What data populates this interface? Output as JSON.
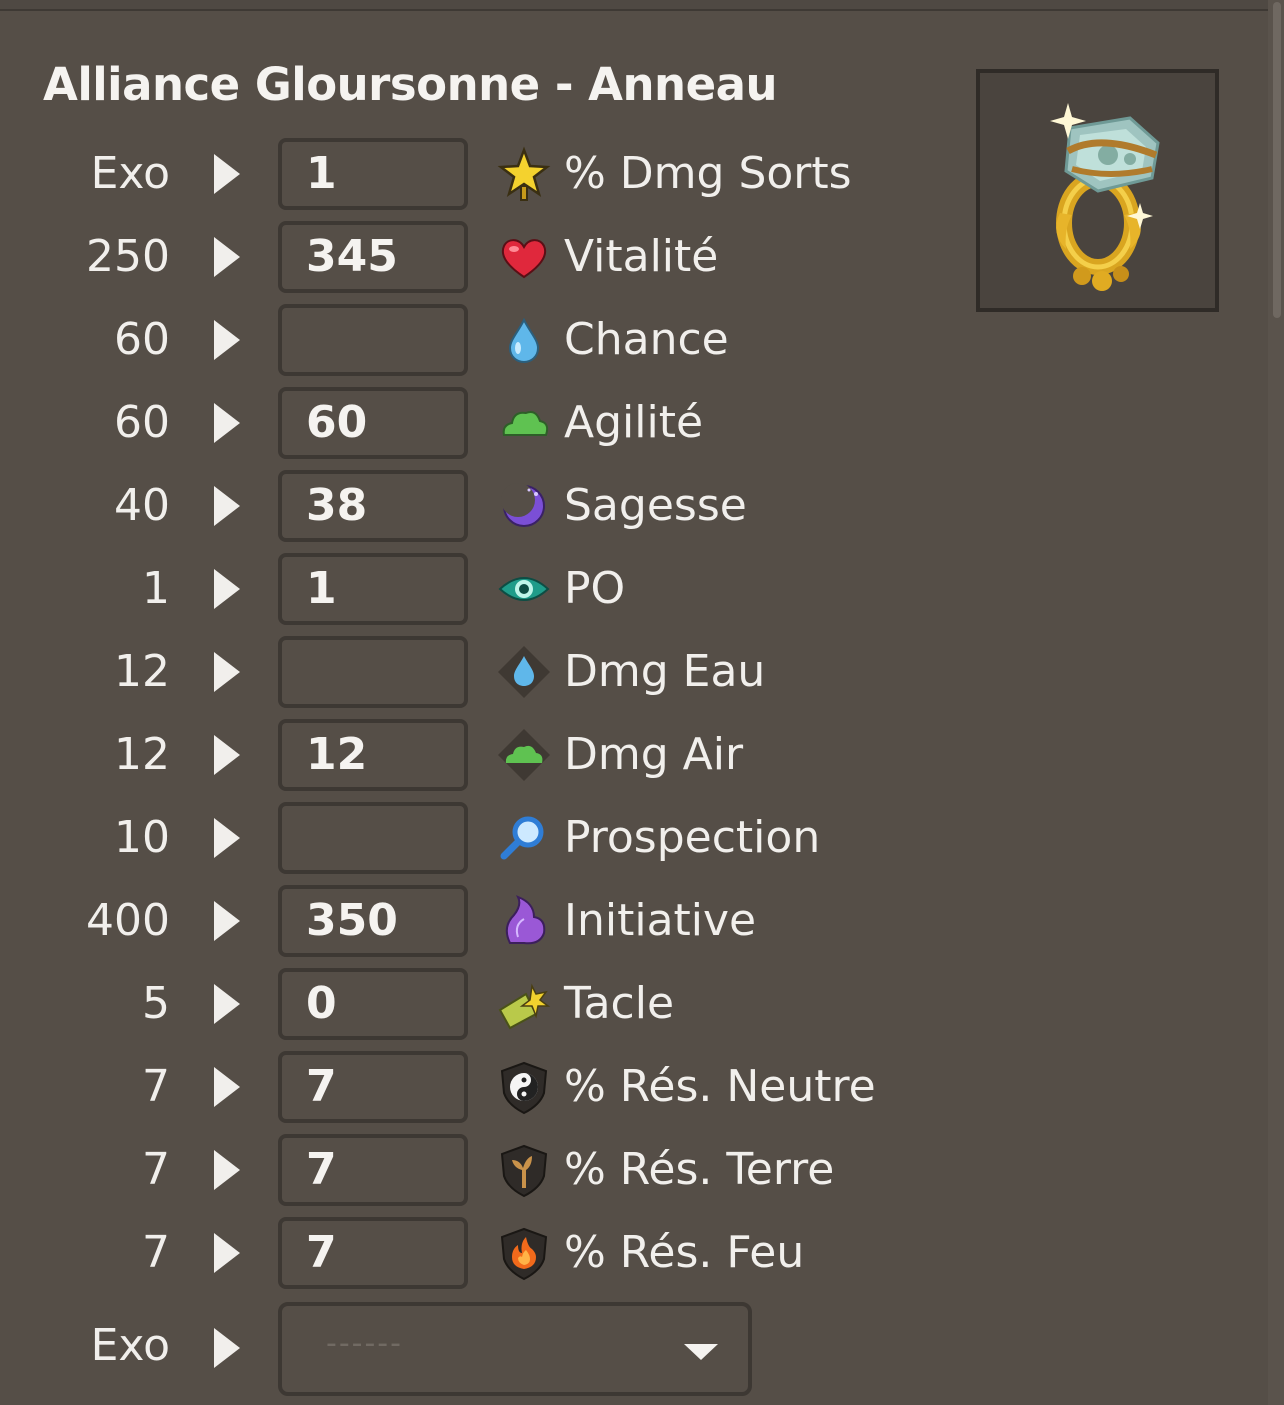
{
  "title": "Alliance Gloursonne - Anneau",
  "item_image": "ring-item-image",
  "rows": [
    {
      "min": "Exo",
      "value": "1",
      "icon": "star-icon",
      "label": "% Dmg Sorts"
    },
    {
      "min": "250",
      "value": "345",
      "icon": "heart-icon",
      "label": "Vitalité"
    },
    {
      "min": "60",
      "value": "",
      "icon": "water-drop-icon",
      "label": "Chance"
    },
    {
      "min": "60",
      "value": "60",
      "icon": "cloud-icon",
      "label": "Agilité"
    },
    {
      "min": "40",
      "value": "38",
      "icon": "moon-icon",
      "label": "Sagesse"
    },
    {
      "min": "1",
      "value": "1",
      "icon": "eye-icon",
      "label": "PO"
    },
    {
      "min": "12",
      "value": "",
      "icon": "water-damage-icon",
      "label": "Dmg Eau"
    },
    {
      "min": "12",
      "value": "12",
      "icon": "air-damage-icon",
      "label": "Dmg Air"
    },
    {
      "min": "10",
      "value": "",
      "icon": "magnifier-icon",
      "label": "Prospection"
    },
    {
      "min": "400",
      "value": "350",
      "icon": "wing-icon",
      "label": "Initiative"
    },
    {
      "min": "5",
      "value": "0",
      "icon": "tackle-icon",
      "label": "Tacle"
    },
    {
      "min": "7",
      "value": "7",
      "icon": "neutral-res-icon",
      "label": "% Rés. Neutre"
    },
    {
      "min": "7",
      "value": "7",
      "icon": "earth-res-icon",
      "label": "% Rés. Terre"
    },
    {
      "min": "7",
      "value": "7",
      "icon": "fire-res-icon",
      "label": "% Rés. Feu"
    }
  ],
  "exo_select": {
    "min": "Exo",
    "placeholder": "------"
  }
}
